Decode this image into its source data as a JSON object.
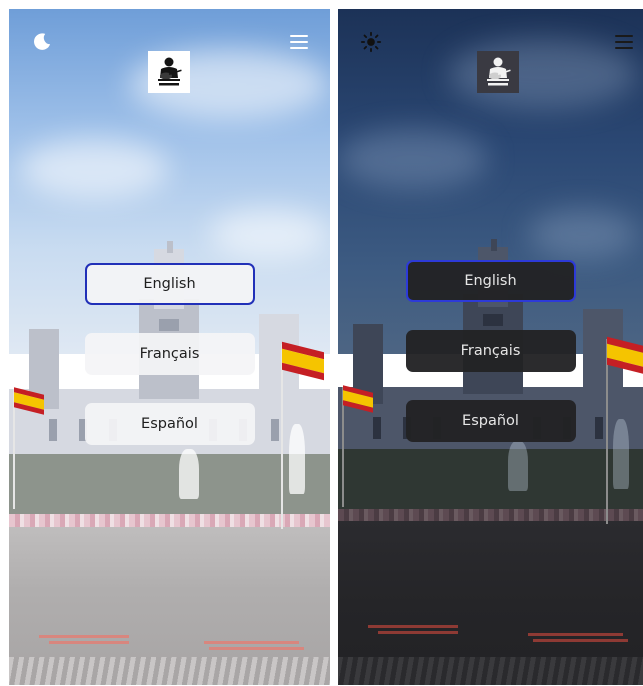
{
  "theme_colors": {
    "light_button_bg": "#f4f4f6",
    "dark_button_bg": "#222224",
    "selected_border": "#2130b8"
  },
  "light_screen": {
    "theme_toggle_icon": "moon-icon",
    "menu_icon": "hamburger-menu-icon",
    "logo_icon": "guitarist-logo-icon",
    "languages": [
      {
        "label": "English",
        "selected": true
      },
      {
        "label": "Français",
        "selected": false
      },
      {
        "label": "Español",
        "selected": false
      }
    ]
  },
  "dark_screen": {
    "theme_toggle_icon": "sun-icon",
    "menu_icon": "hamburger-menu-icon",
    "logo_icon": "guitarist-logo-icon",
    "languages": [
      {
        "label": "English",
        "selected": true
      },
      {
        "label": "Français",
        "selected": false
      },
      {
        "label": "Español",
        "selected": false
      }
    ]
  }
}
